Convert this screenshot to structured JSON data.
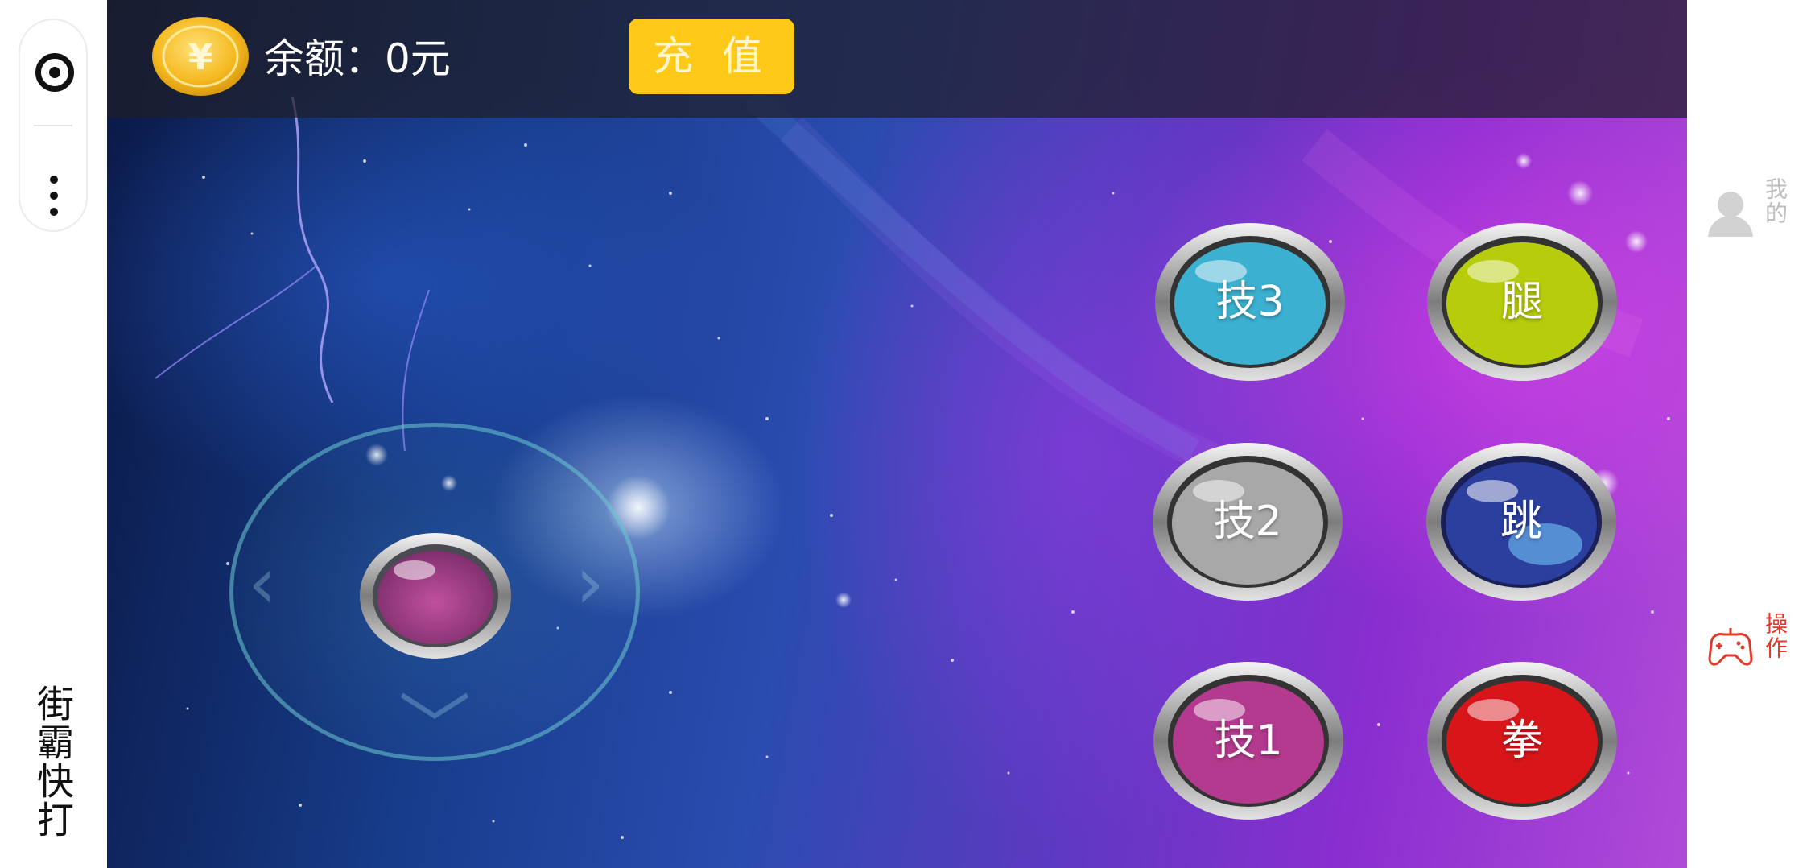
{
  "app": {
    "title": "街霸快打"
  },
  "top_bar": {
    "coin_symbol": "¥",
    "balance_text": "余额：0元",
    "recharge_label": "充 值"
  },
  "controls": {
    "joystick": {
      "arrows": [
        "‹",
        "›",
        "﹀"
      ]
    },
    "buttons": {
      "skill3": {
        "label": "技3",
        "color": "#3cb0d0"
      },
      "kick": {
        "label": "腿",
        "color": "#b7cc0a"
      },
      "skill2": {
        "label": "技2",
        "color": "#a8a8a8"
      },
      "jump": {
        "label": "跳",
        "color": "#2b3f9e"
      },
      "skill1": {
        "label": "技1",
        "color": "#b33a8e"
      },
      "punch": {
        "label": "拳",
        "color": "#d8161a"
      }
    }
  },
  "tabs": [
    {
      "label": "我的",
      "icon": "user-icon",
      "active": false
    },
    {
      "label": "操作",
      "icon": "gamepad-icon",
      "active": true
    }
  ],
  "colors": {
    "accent_yellow": "#ffc918",
    "active_tab": "#e03a2a",
    "inactive_tab": "#bdbdbd"
  }
}
